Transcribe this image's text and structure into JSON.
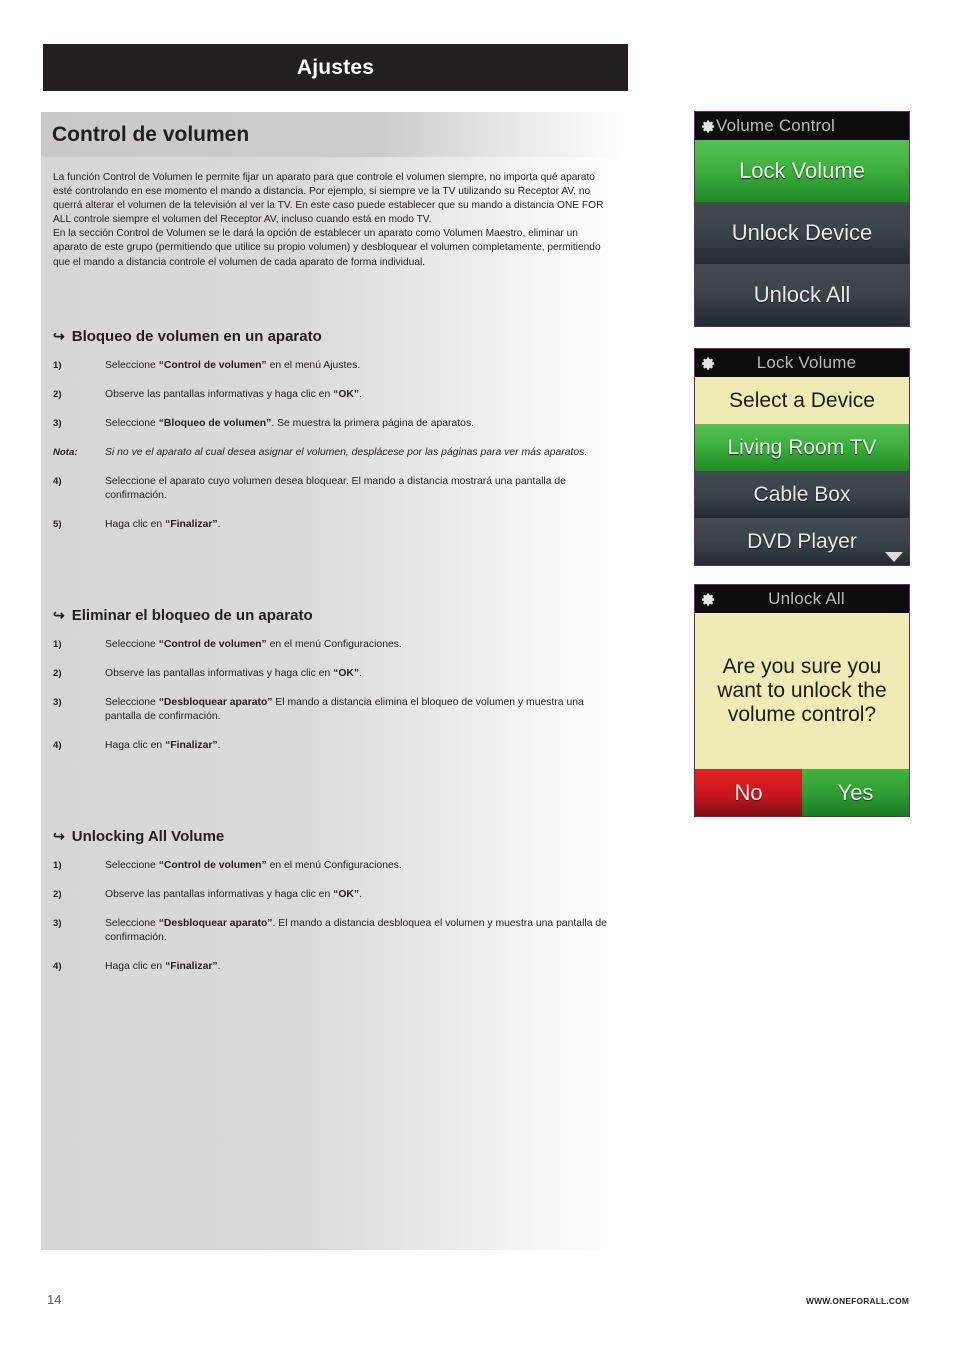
{
  "header": {
    "title": "Ajustes"
  },
  "page": {
    "title": "Control de volumen",
    "intro_p1": "La función Control de Volumen le permite fijar un aparato para que controle el volumen siempre, no importa qué aparato esté controlando en ese momento el mando a distancia.  Por ejemplo, si siempre ve la TV utilizando su Receptor AV, no querrá alterar el volumen de la televisión al ver la TV. En este caso puede establecer que su mando a distancia ONE FOR ALL controle siempre el volumen del Receptor AV, incluso cuando está en modo TV.",
    "intro_p2": "En la sección Control de Volumen se le dará la opción de establecer un aparato como Volumen Maestro, eliminar un aparato de este grupo (permitiendo que utilice su propio volumen) y desbloquear el volumen completamente, permitiendo que el mando a distancia controle el volumen de cada aparato de forma individual."
  },
  "section1": {
    "arrow": "↪",
    "heading": "Bloqueo de volumen en un aparato",
    "steps": [
      {
        "num": "1)",
        "html": "Seleccione <b>“Control de volumen”</b> en el menú Ajustes."
      },
      {
        "num": "2)",
        "html": "Observe las pantallas informativas y haga clic en <b>“OK”</b>."
      },
      {
        "num": "3)",
        "html": "Seleccione <b>“Bloqueo de volumen”</b>. Se muestra la primera página de aparatos."
      },
      {
        "num": "Nota:",
        "note": true,
        "italic": true,
        "html": "Si no ve el aparato al cual desea asignar el volumen, desplácese por las páginas para ver más aparatos."
      },
      {
        "num": "4)",
        "html": "Seleccione el aparato cuyo volumen desea bloquear. El mando a distancia mostrará una pantalla de confirmación."
      },
      {
        "num": "5)",
        "html": "Haga clic en <b>“Finalizar”</b>."
      }
    ]
  },
  "section2": {
    "arrow": "↪",
    "heading": "Eliminar el bloqueo de un aparato",
    "steps": [
      {
        "num": "1)",
        "html": "Seleccione <b>“Control de volumen”</b> en el menú Configuraciones."
      },
      {
        "num": "2)",
        "html": "Observe las pantallas informativas y haga clic en <b>“OK”</b>."
      },
      {
        "num": "3)",
        "html": "Seleccione <b>“Desbloquear aparato”</b> El mando a distancia elimina el bloqueo de volumen y muestra una pantalla de confirmación."
      },
      {
        "num": "4)",
        "html": "Haga clic en <b>“Finalizar”</b>."
      }
    ]
  },
  "section3": {
    "arrow": "↪",
    "heading": "Unlocking All Volume",
    "steps": [
      {
        "num": "1)",
        "html": "Seleccione <b>“Control de volumen”</b> en el menú Configuraciones."
      },
      {
        "num": "2)",
        "html": "Observe las pantallas informativas y haga clic en <b>“OK”</b>."
      },
      {
        "num": "3)",
        "html": "Seleccione <b>“Desbloquear aparato”</b>. El mando a distancia desbloquea el volumen y muestra una pantalla de confirmación."
      },
      {
        "num": "4)",
        "html": "Haga clic en <b>“Finalizar”</b>."
      }
    ]
  },
  "screens": {
    "screen1": {
      "header": "Volume Control",
      "icon": "gear-icon",
      "rows": [
        {
          "label": "Lock Volume",
          "state": "selected",
          "color": "#2f9a34"
        },
        {
          "label": "Unlock Device",
          "state": "normal",
          "color": "#39434a"
        },
        {
          "label": "Unlock All",
          "state": "normal",
          "color": "#39434a"
        }
      ]
    },
    "screen2": {
      "header": "Lock Volume",
      "icon": "gear-icon",
      "prompt": "Select a Device",
      "prompt_color": "#eeecb4",
      "rows": [
        {
          "label": "Living Room TV",
          "state": "selected",
          "color": "#2f9a34"
        },
        {
          "label": "Cable Box",
          "state": "normal",
          "color": "#39434a"
        },
        {
          "label": "DVD Player",
          "state": "normal",
          "color": "#39434a",
          "more": "chevron-down-icon"
        }
      ]
    },
    "screen3": {
      "header": "Unlock All",
      "icon": "gear-icon",
      "message": "Are you sure you want to unlock the volume control?",
      "message_color": "#eeecb4",
      "buttons": [
        {
          "label": "No",
          "color": "#c8161d"
        },
        {
          "label": "Yes",
          "color": "#2e9b33"
        }
      ]
    }
  },
  "footer": {
    "page_number": "14",
    "website": "WWW.ONEFORALL.COM"
  }
}
